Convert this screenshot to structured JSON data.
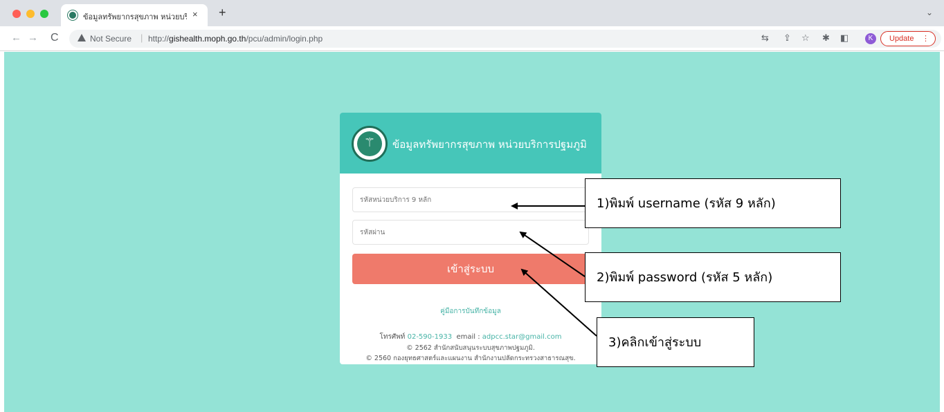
{
  "browser": {
    "tab_title": "ข้อมูลทรัพยากรสุขภาพ หน่วยบริการ",
    "tab_close": "×",
    "new_tab": "+",
    "tab_dropdown": "⌄",
    "back": "←",
    "forward": "→",
    "reload": "C",
    "security_label": "Not Secure",
    "url_scheme": "http://",
    "url_host": "gishealth.moph.go.th",
    "url_path": "/pcu/admin/login.php",
    "profile_initial": "K",
    "update_label": "Update",
    "update_menu": "⋮"
  },
  "login": {
    "title": "ข้อมูลทรัพยากรสุขภาพ หน่วยบริการปฐมภูมิ",
    "username_placeholder": "รหัสหน่วยบริการ 9 หลัก",
    "password_placeholder": "รหัสผ่าน",
    "submit_label": "เข้าสู่ระบบ",
    "manual_link": "คู่มือการบันทึกข้อมูล",
    "phone_label": "โทรศัพท์",
    "phone": "02-590-1933",
    "email_label": "email :",
    "email": "adpcc.star@gmail.com",
    "copyright_1": "© 2562 สำนักสนับสนุนระบบสุขภาพปฐมภูมิ.",
    "copyright_2": "© 2560 กองยุทธศาสตร์และแผนงาน สำนักงานปลัดกระทรวงสาธารณสุข."
  },
  "annotations": {
    "step1": "1)พิมพ์ username (รหัส 9 หลัก)",
    "step2": "2)พิมพ์ password (รหัส 5 หลัก)",
    "step3": "3)คลิกเข้าสู่ระบบ"
  },
  "colors": {
    "page_background": "#94e3d6",
    "header": "#46c6b9",
    "button": "#ef7a6b",
    "link": "#46b3a6"
  }
}
